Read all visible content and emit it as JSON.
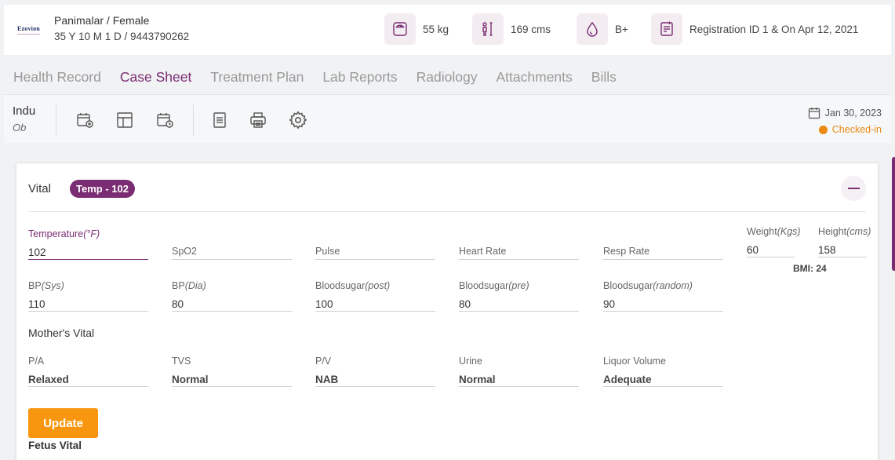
{
  "patient": {
    "logo_text": "Ezovion",
    "name_gender": "Panimalar / Female",
    "age_phone": "35 Y 10 M 1 D / 9443790262",
    "weight": "55 kg",
    "height": "169 cms",
    "blood_group": "B+",
    "registration": "Registration ID 1 & On Apr 12, 2021"
  },
  "tabs": [
    {
      "label": "Health Record",
      "active": false
    },
    {
      "label": "Case Sheet",
      "active": true
    },
    {
      "label": "Treatment Plan",
      "active": false
    },
    {
      "label": "Lab Reports",
      "active": false
    },
    {
      "label": "Radiology",
      "active": false
    },
    {
      "label": "Attachments",
      "active": false
    },
    {
      "label": "Bills",
      "active": false
    }
  ],
  "toolbar": {
    "doctor_name": "Indu",
    "department": "Ob",
    "date": "Jan 30, 2023",
    "status": "Checked-in",
    "icons": [
      "calendar-plus-icon",
      "layout-icon",
      "calendar-clock-icon",
      "document-icon",
      "print-icon",
      "settings-icon"
    ]
  },
  "vital": {
    "title": "Vital",
    "badge": "Temp - 102",
    "fields": {
      "temperature": {
        "label": "Temperature",
        "unit": "(°F)",
        "value": "102"
      },
      "spo2": {
        "label": "SpO2",
        "value": ""
      },
      "pulse": {
        "label": "Pulse",
        "value": ""
      },
      "heart_rate": {
        "label": "Heart Rate",
        "value": ""
      },
      "resp_rate": {
        "label": "Resp Rate",
        "value": ""
      },
      "weight": {
        "label": "Weight",
        "unit": "(Kgs)",
        "value": "60"
      },
      "height": {
        "label": "Height",
        "unit": "(cms)",
        "value": "158"
      },
      "bp_sys": {
        "label": "BP",
        "unit": "(Sys)",
        "value": "110"
      },
      "bp_dia": {
        "label": "BP",
        "unit": "(Dia)",
        "value": "80"
      },
      "sugar_post": {
        "label": "Bloodsugar",
        "unit": "(post)",
        "value": "100"
      },
      "sugar_pre": {
        "label": "Bloodsugar",
        "unit": "(pre)",
        "value": "80"
      },
      "sugar_random": {
        "label": "Bloodsugar",
        "unit": "(random)",
        "value": "90"
      }
    },
    "bmi": "BMI: 24"
  },
  "mother_vital": {
    "title": "Mother's Vital",
    "fields": {
      "pa": {
        "label": "P/A",
        "value": "Relaxed"
      },
      "tvs": {
        "label": "TVS",
        "value": "Normal"
      },
      "pv": {
        "label": "P/V",
        "value": "NAB"
      },
      "urine": {
        "label": "Urine",
        "value": "Normal"
      },
      "liquor": {
        "label": "Liquor Volume",
        "value": "Adequate"
      }
    }
  },
  "update_label": "Update",
  "fetus_title": "Fetus Vital",
  "colors": {
    "brand": "#7b2d73",
    "accent": "#f9960f",
    "status": "#e98b14"
  }
}
